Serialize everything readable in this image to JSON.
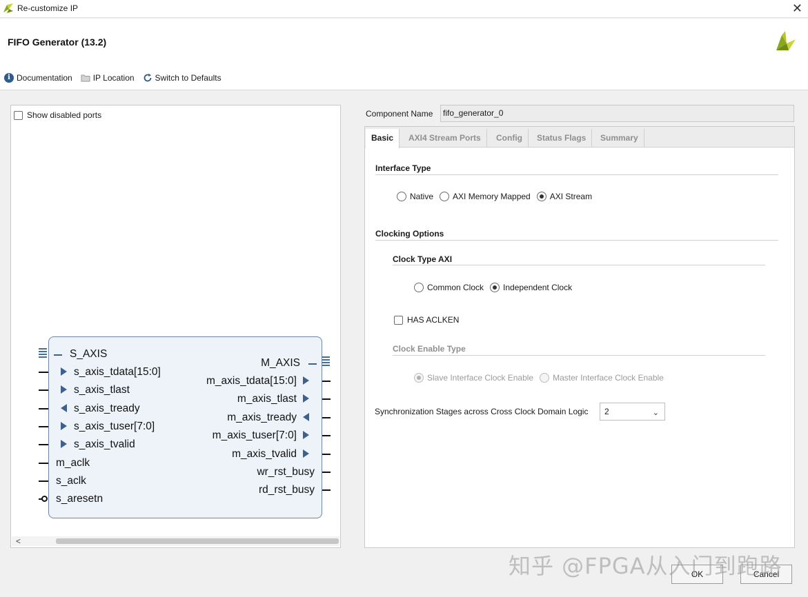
{
  "window": {
    "title": "Re-customize IP"
  },
  "header": {
    "ip_title": "FIFO Generator (13.2)"
  },
  "toolbar": {
    "documentation": "Documentation",
    "ip_location": "IP Location",
    "switch_defaults": "Switch to Defaults"
  },
  "left": {
    "show_disabled_ports": "Show disabled ports",
    "block": {
      "left_ports": {
        "s_axis": "S_AXIS",
        "tdata": "s_axis_tdata[15:0]",
        "tlast": "s_axis_tlast",
        "tready": "s_axis_tready",
        "tuser": "s_axis_tuser[7:0]",
        "tvalid": "s_axis_tvalid",
        "m_aclk": "m_aclk",
        "s_aclk": "s_aclk",
        "s_aresetn": "s_aresetn"
      },
      "right_ports": {
        "m_axis": "M_AXIS",
        "tdata": "m_axis_tdata[15:0]",
        "tlast": "m_axis_tlast",
        "tready": "m_axis_tready",
        "tuser": "m_axis_tuser[7:0]",
        "tvalid": "m_axis_tvalid",
        "wr_rst_busy": "wr_rst_busy",
        "rd_rst_busy": "rd_rst_busy"
      }
    }
  },
  "right": {
    "component_name_label": "Component Name",
    "component_name_value": "fifo_generator_0",
    "tabs": [
      {
        "label": "Basic",
        "active": true
      },
      {
        "label": "AXI4 Stream Ports",
        "active": false
      },
      {
        "label": "Config",
        "active": false
      },
      {
        "label": "Status Flags",
        "active": false
      },
      {
        "label": "Summary",
        "active": false
      }
    ],
    "interface_type": {
      "title": "Interface Type",
      "options": [
        "Native",
        "AXI Memory Mapped",
        "AXI Stream"
      ],
      "selected": "AXI Stream"
    },
    "clocking": {
      "title": "Clocking Options",
      "clock_type_title": "Clock Type AXI",
      "clock_options": [
        "Common Clock",
        "Independent Clock"
      ],
      "clock_selected": "Independent Clock",
      "has_aclken": "HAS ACLKEN",
      "clock_enable_title": "Clock Enable Type",
      "enable_options": [
        "Slave Interface Clock Enable",
        "Master Interface Clock Enable"
      ],
      "enable_selected": "Slave Interface Clock Enable"
    },
    "sync": {
      "label": "Synchronization Stages across Cross Clock Domain Logic",
      "value": "2"
    }
  },
  "buttons": {
    "ok": "OK",
    "cancel": "Cancel"
  },
  "watermark": "知乎 @FPGA从入门到跑路"
}
